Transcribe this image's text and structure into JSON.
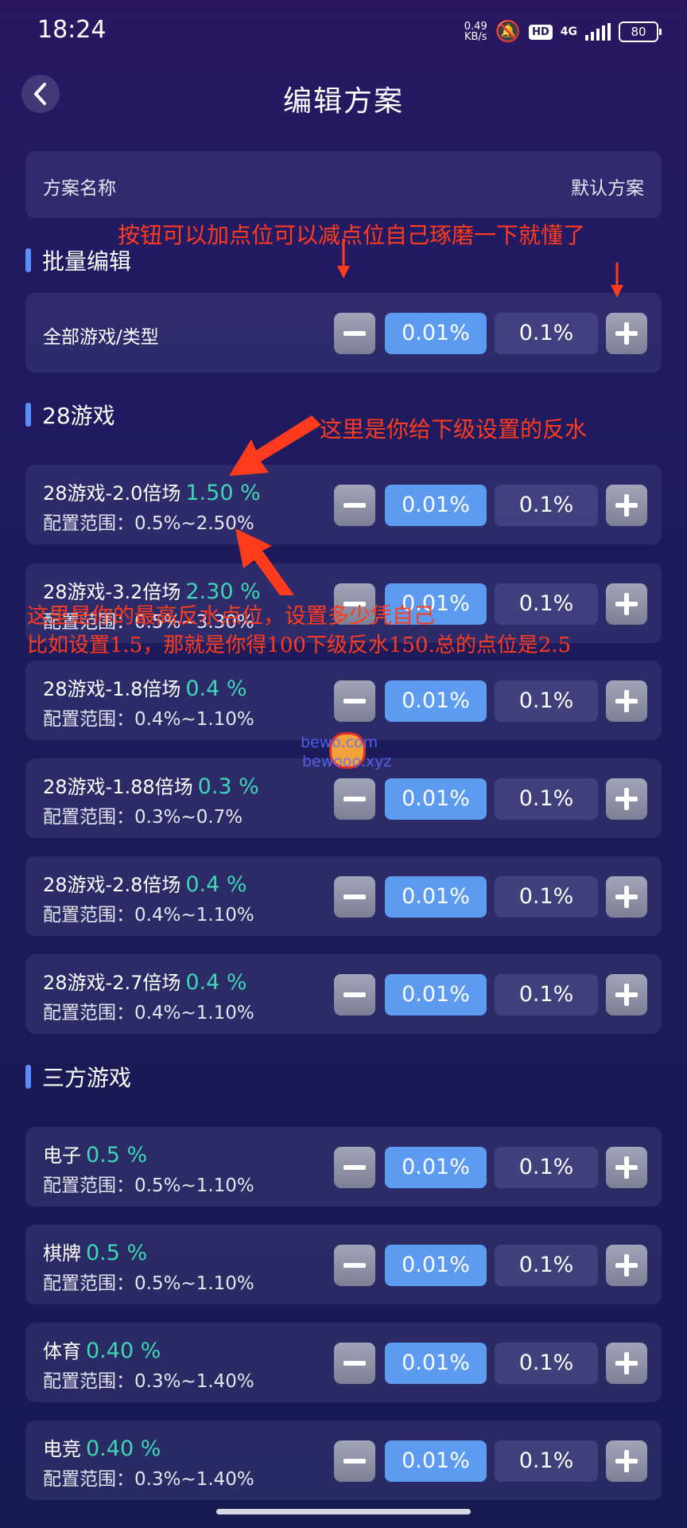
{
  "status_bar": {
    "time": "18:24",
    "net_speed_value": "0.49",
    "net_speed_unit": "KB/s",
    "hd": "HD",
    "network": "4G",
    "battery": "80"
  },
  "header": {
    "title": "编辑方案"
  },
  "plan": {
    "label": "方案名称",
    "value": "默认方案"
  },
  "batch": {
    "section_title": "批量编辑",
    "label": "全部游戏/类型",
    "step_selected": "0.01%",
    "step_alt": "0.1%"
  },
  "game28": {
    "section_title": "28游戏",
    "items": [
      {
        "name": "28游戏-2.0倍场",
        "percent": "1.50 %",
        "range": "配置范围：0.5%~2.50%",
        "step_selected": "0.01%",
        "step_alt": "0.1%"
      },
      {
        "name": "28游戏-3.2倍场",
        "percent": "2.30 %",
        "range": "配置范围：0.5%~3.30%",
        "step_selected": "0.01%",
        "step_alt": "0.1%"
      },
      {
        "name": "28游戏-1.8倍场",
        "percent": "0.4 %",
        "range": "配置范围：0.4%~1.10%",
        "step_selected": "0.01%",
        "step_alt": "0.1%"
      },
      {
        "name": "28游戏-1.88倍场",
        "percent": "0.3 %",
        "range": "配置范围：0.3%~0.7%",
        "step_selected": "0.01%",
        "step_alt": "0.1%"
      },
      {
        "name": "28游戏-2.8倍场",
        "percent": "0.4 %",
        "range": "配置范围：0.4%~1.10%",
        "step_selected": "0.01%",
        "step_alt": "0.1%"
      },
      {
        "name": "28游戏-2.7倍场",
        "percent": "0.4 %",
        "range": "配置范围：0.4%~1.10%",
        "step_selected": "0.01%",
        "step_alt": "0.1%"
      }
    ]
  },
  "third_party": {
    "section_title": "三方游戏",
    "items": [
      {
        "name": "电子",
        "percent": "0.5 %",
        "range": "配置范围：0.5%~1.10%",
        "step_selected": "0.01%",
        "step_alt": "0.1%"
      },
      {
        "name": "棋牌",
        "percent": "0.5 %",
        "range": "配置范围：0.5%~1.10%",
        "step_selected": "0.01%",
        "step_alt": "0.1%"
      },
      {
        "name": "体育",
        "percent": "0.40 %",
        "range": "配置范围：0.3%~1.40%",
        "step_selected": "0.01%",
        "step_alt": "0.1%"
      },
      {
        "name": "电竞",
        "percent": "0.40 %",
        "range": "配置范围：0.3%~1.40%",
        "step_selected": "0.01%",
        "step_alt": "0.1%"
      }
    ]
  },
  "annotations": {
    "note1": "按钮可以加点位可以减点位自己琢磨一下就懂了",
    "note2": "这里是你给下级设置的反水",
    "note3": "这里是你的最高反水点位，设置多少凭自己",
    "note4": "比如设置1.5，那就是你得100下级反水150.总的点位是2.5",
    "color": "#ff3b1e"
  },
  "watermark": {
    "line1": "bewo.com",
    "line2": "bewooo.xyz"
  },
  "colors": {
    "accent": "#5d9bf0",
    "percent": "#3ed6b4",
    "section_bar": "#5b8dff"
  }
}
